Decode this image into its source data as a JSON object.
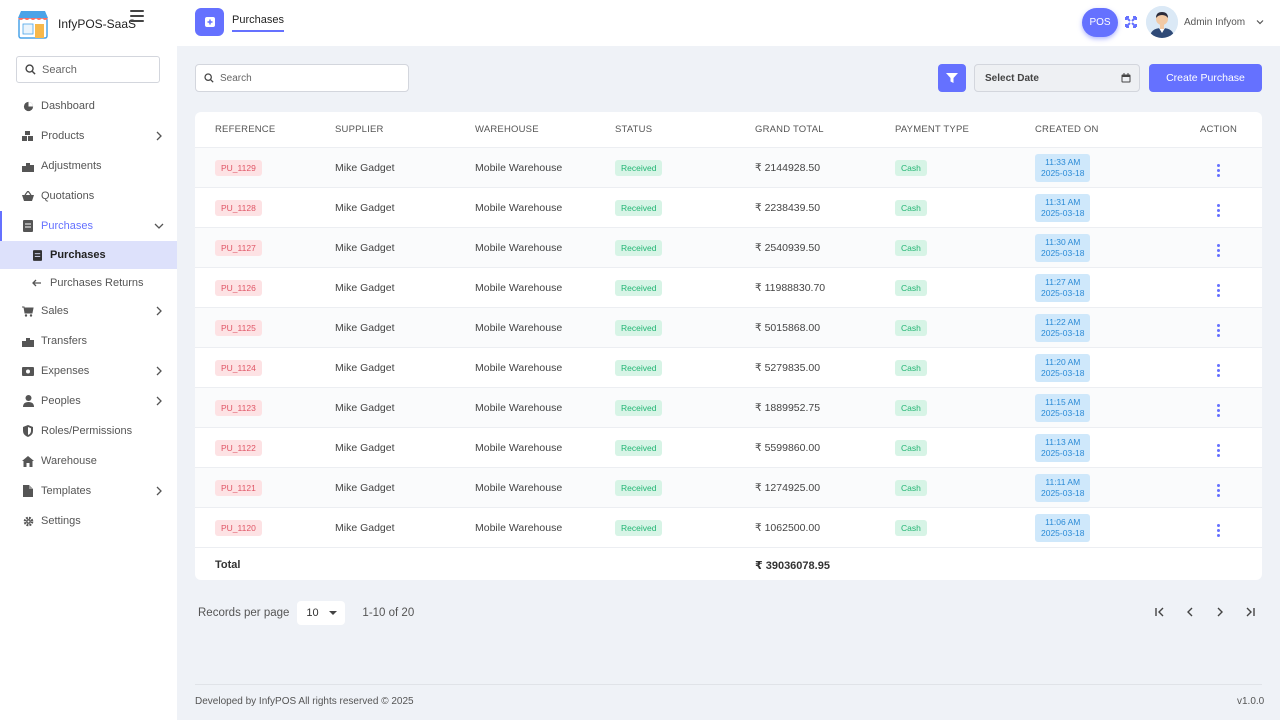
{
  "app": {
    "name": "InfyPOS-SaaS"
  },
  "sidebar": {
    "search_placeholder": "Search",
    "items": [
      {
        "label": "Dashboard",
        "icon": "dashboard-icon"
      },
      {
        "label": "Products",
        "icon": "products-icon"
      },
      {
        "label": "Adjustments",
        "icon": "adjustments-icon"
      },
      {
        "label": "Quotations",
        "icon": "quotations-icon"
      },
      {
        "label": "Purchases",
        "icon": "purchases-icon",
        "active": true
      },
      {
        "label": "Sales",
        "icon": "cart-icon"
      },
      {
        "label": "Transfers",
        "icon": "transfers-icon"
      },
      {
        "label": "Expenses",
        "icon": "money-icon"
      },
      {
        "label": "Peoples",
        "icon": "user-icon"
      },
      {
        "label": "Roles/Permissions",
        "icon": "shield-icon"
      },
      {
        "label": "Warehouse",
        "icon": "home-icon"
      },
      {
        "label": "Templates",
        "icon": "file-icon"
      },
      {
        "label": "Settings",
        "icon": "gear-icon"
      }
    ],
    "purchases_sub": [
      {
        "label": "Purchases",
        "selected": true
      },
      {
        "label": "Purchases Returns"
      }
    ]
  },
  "header": {
    "tab": "Purchases",
    "pos_label": "POS",
    "user_name": "Admin Infyom"
  },
  "toolbar": {
    "search_placeholder": "Search",
    "date_placeholder": "Select Date",
    "create_label": "Create Purchase"
  },
  "table": {
    "columns": [
      "REFERENCE",
      "SUPPLIER",
      "WAREHOUSE",
      "STATUS",
      "GRAND TOTAL",
      "PAYMENT TYPE",
      "CREATED ON",
      "ACTION"
    ],
    "rows": [
      {
        "ref": "PU_1129",
        "supplier": "Mike Gadget",
        "warehouse": "Mobile Warehouse",
        "status": "Received",
        "total": "₹ 2144928.50",
        "payment": "Cash",
        "time": "11:33 AM",
        "date": "2025-03-18"
      },
      {
        "ref": "PU_1128",
        "supplier": "Mike Gadget",
        "warehouse": "Mobile Warehouse",
        "status": "Received",
        "total": "₹ 2238439.50",
        "payment": "Cash",
        "time": "11:31 AM",
        "date": "2025-03-18"
      },
      {
        "ref": "PU_1127",
        "supplier": "Mike Gadget",
        "warehouse": "Mobile Warehouse",
        "status": "Received",
        "total": "₹ 2540939.50",
        "payment": "Cash",
        "time": "11:30 AM",
        "date": "2025-03-18"
      },
      {
        "ref": "PU_1126",
        "supplier": "Mike Gadget",
        "warehouse": "Mobile Warehouse",
        "status": "Received",
        "total": "₹ 11988830.70",
        "payment": "Cash",
        "time": "11:27 AM",
        "date": "2025-03-18"
      },
      {
        "ref": "PU_1125",
        "supplier": "Mike Gadget",
        "warehouse": "Mobile Warehouse",
        "status": "Received",
        "total": "₹ 5015868.00",
        "payment": "Cash",
        "time": "11:22 AM",
        "date": "2025-03-18"
      },
      {
        "ref": "PU_1124",
        "supplier": "Mike Gadget",
        "warehouse": "Mobile Warehouse",
        "status": "Received",
        "total": "₹ 5279835.00",
        "payment": "Cash",
        "time": "11:20 AM",
        "date": "2025-03-18"
      },
      {
        "ref": "PU_1123",
        "supplier": "Mike Gadget",
        "warehouse": "Mobile Warehouse",
        "status": "Received",
        "total": "₹ 1889952.75",
        "payment": "Cash",
        "time": "11:15 AM",
        "date": "2025-03-18"
      },
      {
        "ref": "PU_1122",
        "supplier": "Mike Gadget",
        "warehouse": "Mobile Warehouse",
        "status": "Received",
        "total": "₹ 5599860.00",
        "payment": "Cash",
        "time": "11:13 AM",
        "date": "2025-03-18"
      },
      {
        "ref": "PU_1121",
        "supplier": "Mike Gadget",
        "warehouse": "Mobile Warehouse",
        "status": "Received",
        "total": "₹ 1274925.00",
        "payment": "Cash",
        "time": "11:11 AM",
        "date": "2025-03-18"
      },
      {
        "ref": "PU_1120",
        "supplier": "Mike Gadget",
        "warehouse": "Mobile Warehouse",
        "status": "Received",
        "total": "₹ 1062500.00",
        "payment": "Cash",
        "time": "11:06 AM",
        "date": "2025-03-18"
      }
    ],
    "total_label": "Total",
    "total_value": "₹ 39036078.95"
  },
  "pagination": {
    "records_label": "Records per page",
    "per_page": "10",
    "range": "1-10 of 20"
  },
  "footer": {
    "left": "Developed by InfyPOS All rights reserved © 2025",
    "version": "v1.0.0"
  },
  "colors": {
    "accent": "#6571ff",
    "success": "#22b573",
    "danger": "#e05565",
    "info": "#2a8ad6"
  }
}
